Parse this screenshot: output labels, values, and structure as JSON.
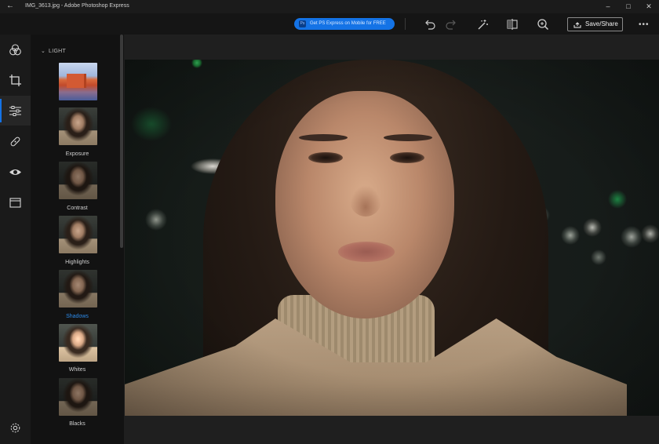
{
  "titlebar": {
    "title": "IMG_3613.jpg - Adobe Photoshop Express",
    "back_icon": "back-arrow-icon",
    "controls": [
      "minimize",
      "maximize",
      "close"
    ]
  },
  "toolbar": {
    "promo_label": "Get PS Express on Mobile for FREE",
    "save_share_label": "Save/Share",
    "buttons": [
      "undo-icon",
      "redo-icon",
      "auto-enhance-icon",
      "compare-icon",
      "zoom-icon"
    ],
    "more_label": "•••"
  },
  "rail": {
    "items": [
      "looks",
      "crop",
      "adjust",
      "heal",
      "eye",
      "border"
    ],
    "active": "adjust",
    "settings_icon": "gear-icon"
  },
  "panel": {
    "section_label": "LIGHT",
    "items": [
      {
        "label": ""
      },
      {
        "label": "Exposure"
      },
      {
        "label": "Contrast"
      },
      {
        "label": "Highlights"
      },
      {
        "label": "Shadows"
      },
      {
        "label": "Whites"
      },
      {
        "label": "Blacks"
      }
    ],
    "selected": "Shadows"
  },
  "colors": {
    "accent": "#1473e6",
    "selected_text": "#2d8ae8",
    "background": "#1e1e1e"
  }
}
